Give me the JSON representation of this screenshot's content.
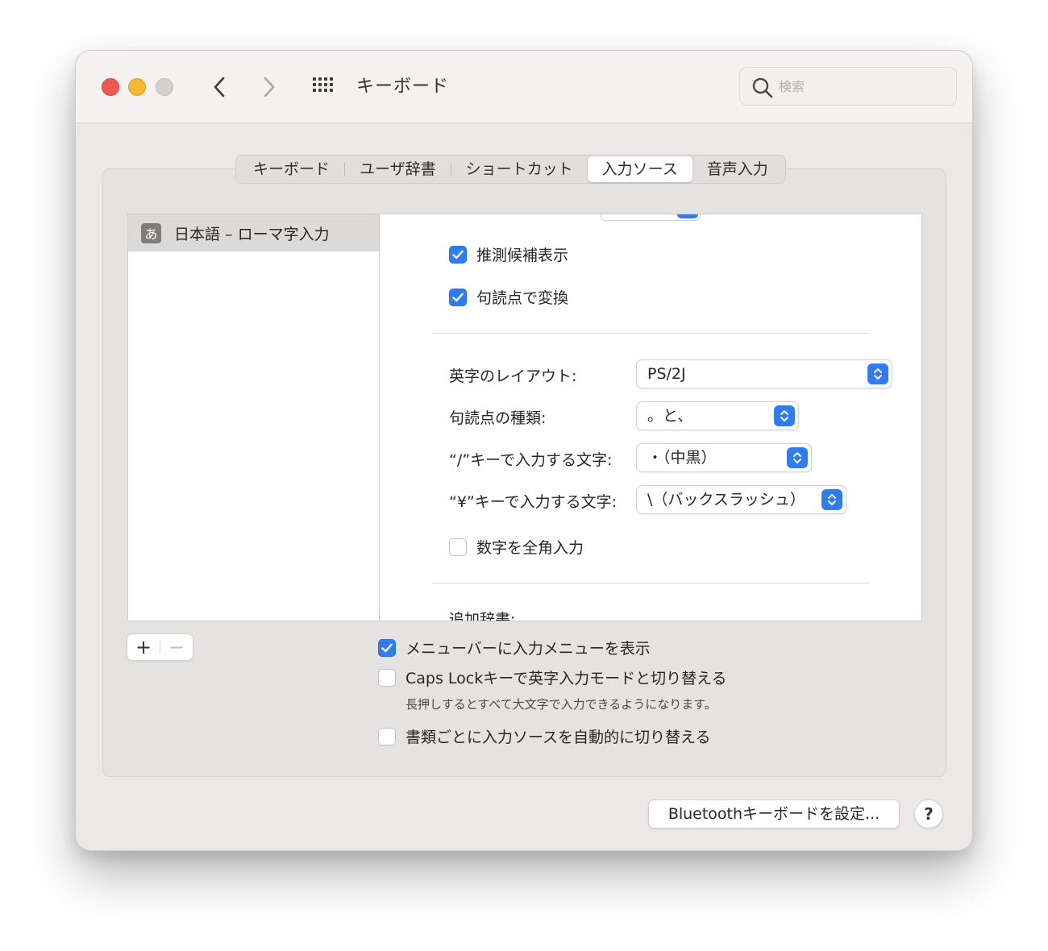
{
  "window": {
    "title": "キーボード",
    "search_placeholder": "検索"
  },
  "tabs": [
    {
      "label": "キーボード",
      "active": false
    },
    {
      "label": "ユーザ辞書",
      "active": false
    },
    {
      "label": "ショートカット",
      "active": false
    },
    {
      "label": "入力ソース",
      "active": true
    },
    {
      "label": "音声入力",
      "active": false
    }
  ],
  "input_sources": {
    "selected": {
      "badge": "あ",
      "label": "日本語 – ローマ字入力"
    }
  },
  "settings": {
    "predictive_candidates": {
      "label": "推測候補表示",
      "checked": true
    },
    "convert_on_punctuation": {
      "label": "句読点で変換",
      "checked": true
    },
    "alphabet_layout": {
      "label": "英字のレイアウト:",
      "value": "PS/2J"
    },
    "punctuation_type": {
      "label": "句読点の種類:",
      "value": "。と、"
    },
    "slash_key_char": {
      "label": "“/”キーで入力する文字:",
      "value": "・（中黒）"
    },
    "yen_key_char": {
      "label": "“¥”キーで入力する文字:",
      "value": "\\（バックスラッシュ）"
    },
    "fullwidth_numbers": {
      "label": "数字を全角入力",
      "checked": false
    },
    "additional_dictionaries": {
      "label": "追加辞書:"
    }
  },
  "list_controls": {
    "add": "+",
    "remove": "−"
  },
  "options": {
    "show_input_menu": {
      "label": "メニューバーに入力メニューを表示",
      "checked": true
    },
    "caps_lock_switch": {
      "label": "Caps Lockキーで英字入力モードと切り替える",
      "checked": false,
      "note": "長押しするとすべて大文字で入力できるようになります。"
    },
    "auto_switch_per_document": {
      "label": "書類ごとに入力ソースを自動的に切り替える",
      "checked": false
    }
  },
  "footer": {
    "bluetooth_button": "Bluetoothキーボードを設定...",
    "help_button": "?"
  },
  "colors": {
    "accent": "#2f7cf6",
    "close": "#ee5a53",
    "minimize": "#f5b92f",
    "window_bg": "#ece8e7"
  }
}
